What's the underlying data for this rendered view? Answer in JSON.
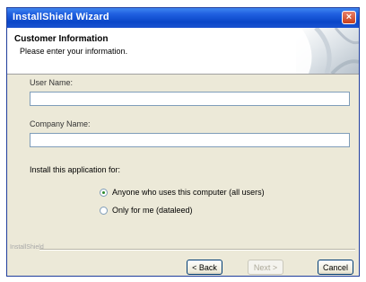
{
  "window": {
    "title": "InstallShield Wizard",
    "close_glyph": "×"
  },
  "header": {
    "title": "Customer Information",
    "subtitle": "Please enter your information."
  },
  "form": {
    "user_name_label": "User Name:",
    "user_name_value": "",
    "company_name_label": "Company Name:",
    "company_name_value": "",
    "install_for_label": "Install this application for:",
    "options": [
      {
        "label": "Anyone who uses this computer (all users)",
        "selected": true
      },
      {
        "label": "Only for me (dataleed)",
        "selected": false
      }
    ]
  },
  "footer": {
    "brand": "InstallShield",
    "back_label": "< Back",
    "next_label": "Next >",
    "next_enabled": false,
    "cancel_label": "Cancel"
  },
  "icons": {
    "close": "close-icon",
    "radio_checked": "radio-checked-icon",
    "radio_unchecked": "radio-unchecked-icon"
  },
  "colors": {
    "titlebar": "#0a46c8",
    "dialog_bg": "#ece9d8",
    "header_bg": "#ffffff",
    "close_button": "#c8401c"
  }
}
